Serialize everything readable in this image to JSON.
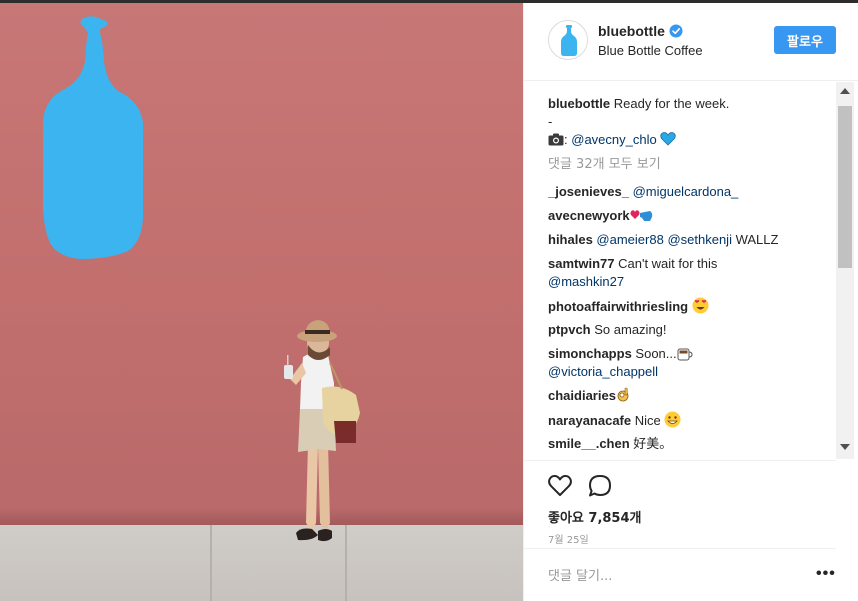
{
  "post": {
    "username": "bluebottle",
    "subtitle": "Blue Bottle Coffee",
    "follow_label": "팔로우",
    "caption_text": "Ready for the week.",
    "caption_dash": "-",
    "credit_prefix": ":",
    "credit_mention": "@avecny_chlo",
    "view_all_comments": "댓글 32개 모두 보기",
    "likes": "좋아요 7,854개",
    "date": "7월 25일",
    "add_comment_placeholder": "댓글 달기...",
    "more_label": "•••"
  },
  "comments": [
    {
      "user": "_josenieves_",
      "text": "",
      "mention": "@miguelcardona_",
      "mention2": ""
    },
    {
      "user": "avecnewyork",
      "text": "",
      "mention": "",
      "mention2": ""
    },
    {
      "user": "hihales",
      "text": "WALLZ",
      "mention": "@ameier88",
      "mention2": "@sethkenji"
    },
    {
      "user": "samtwin77",
      "text": "Can't wait for this",
      "mention": "@mashkin27",
      "mention2": ""
    },
    {
      "user": "photoaffairwithriesling",
      "text": "",
      "mention": "",
      "mention2": ""
    },
    {
      "user": "ptpvch",
      "text": "So amazing!",
      "mention": "",
      "mention2": ""
    },
    {
      "user": "simonchapps",
      "text": "Soon...",
      "mention": "@victoria_chappell",
      "mention2": ""
    },
    {
      "user": "chaidiaries",
      "text": "",
      "mention": "",
      "mention2": ""
    },
    {
      "user": "narayanacafe",
      "text": "Nice",
      "mention": "",
      "mention2": ""
    },
    {
      "user": "smile__.chen",
      "text": "好美。",
      "mention": "",
      "mention2": ""
    }
  ],
  "colors": {
    "accent": "#3897f0",
    "mention": "#003569",
    "wall": "#c27170",
    "bottle": "#3bb4ef"
  },
  "icons": [
    "verified-badge-icon",
    "heart-icon",
    "comment-icon",
    "camera-icon",
    "blue-heart-icon",
    "more-icon"
  ]
}
